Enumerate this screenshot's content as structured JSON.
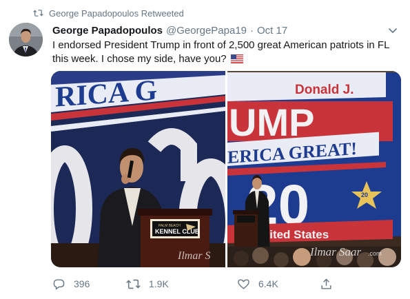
{
  "social_context": {
    "text": "George Papadopoulos Retweeted",
    "icon": "retweet-icon"
  },
  "tweet": {
    "author": {
      "display_name": "George Papadopoulos",
      "handle": "@GeorgePapa19",
      "avatar": "avatar"
    },
    "separator": "·",
    "date": "Oct 17",
    "text": "I endorsed President Trump in front of 2,500 great American patriots in FL this week. I chose my side, have you?",
    "emoji": "flag-us-icon",
    "media": [
      {
        "banner_text": "RICA G",
        "podium_brand_small": "PALM BEACH",
        "podium_brand": "KENNEL CLUB",
        "watermark": "Ilmar S"
      },
      {
        "banner_line_1": "Donald J.",
        "banner_line_2": "UMP",
        "banner_line_3": "ERICA GREAT!",
        "banner_line_4": "20",
        "banner_seal": "20",
        "banner_line_5": "he United States",
        "watermark": "Ilmar Saar",
        "watermark_suffix": ".com"
      }
    ],
    "actions": {
      "reply_count": "396",
      "retweet_count": "1.9K",
      "like_count": "6.4K"
    }
  },
  "colors": {
    "text_primary": "#14171a",
    "text_secondary": "#657786",
    "banner_blue": "#1d3b8f",
    "banner_red": "#c8343a"
  }
}
